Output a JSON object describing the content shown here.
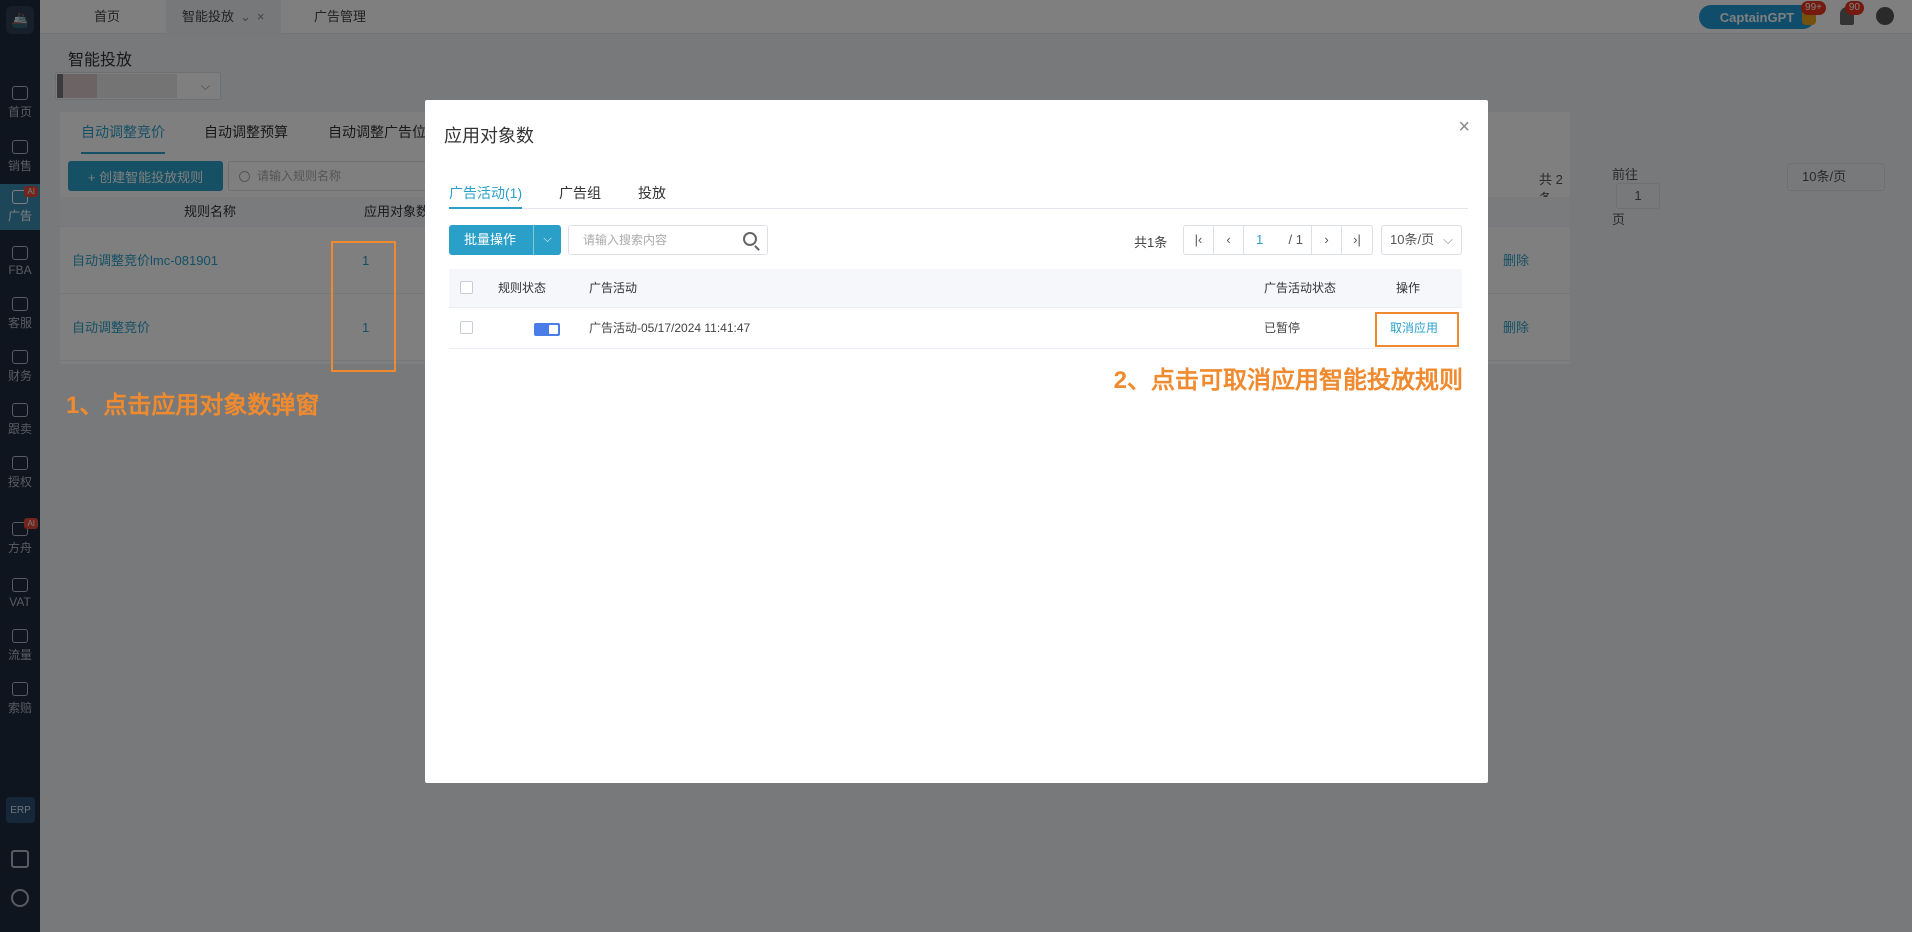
{
  "sidebar": {
    "logo": "🚢",
    "items": [
      {
        "label": "首页"
      },
      {
        "label": "销售"
      },
      {
        "label": "广告",
        "badge": "AI"
      },
      {
        "label": "FBA"
      },
      {
        "label": "客服"
      },
      {
        "label": "财务"
      },
      {
        "label": "跟卖"
      },
      {
        "label": "授权"
      },
      {
        "label": "方舟",
        "badge": "AI"
      },
      {
        "label": "VAT"
      },
      {
        "label": "流量"
      },
      {
        "label": "索赔"
      }
    ],
    "erp_label": "ERP"
  },
  "topbar": {
    "tabs": [
      {
        "label": "首页"
      },
      {
        "label": "智能投放"
      },
      {
        "label": "广告管理"
      }
    ],
    "gpt_label": "CaptainGPT",
    "badge_play": "99+",
    "badge_bell": "90"
  },
  "page": {
    "title": "智能投放",
    "content_tabs": [
      "自动调整竞价",
      "自动调整预算",
      "自动调整广告位"
    ],
    "create_button": "+ 创建智能投放规则",
    "search_placeholder": "请输入规则名称",
    "total": "共 2 条",
    "goto_prefix": "前往",
    "goto_value": "1",
    "goto_suffix": "页",
    "page_size": "10条/页",
    "columns": [
      "规则名称",
      "应用对象数"
    ],
    "rows": [
      {
        "name": "自动调整竞价lmc-081901",
        "count": "1",
        "action": "删除"
      },
      {
        "name": "自动调整竞价",
        "count": "1",
        "action": "删除"
      }
    ]
  },
  "annotations": {
    "step1": "1、点击应用对象数弹窗",
    "step2": "2、点击可取消应用智能投放规则",
    "color": "#f08a2e"
  },
  "modal": {
    "title": "应用对象数",
    "tabs": [
      "广告活动(1)",
      "广告组",
      "投放"
    ],
    "bulk_button": "批量操作",
    "search_placeholder": "请输入搜索内容",
    "total": "共1条",
    "current_page": "1",
    "total_pages": "/ 1",
    "page_size": "10条/页",
    "columns": [
      "规则状态",
      "广告活动",
      "广告活动状态",
      "操作"
    ],
    "rows": [
      {
        "campaign": "广告活动-05/17/2024 11:41:47",
        "status": "已暂停",
        "action": "取消应用"
      }
    ]
  },
  "colors": {
    "accent": "#2aa0c9",
    "sidebar": "#1f2b3d",
    "toggle": "#4a7de8"
  }
}
